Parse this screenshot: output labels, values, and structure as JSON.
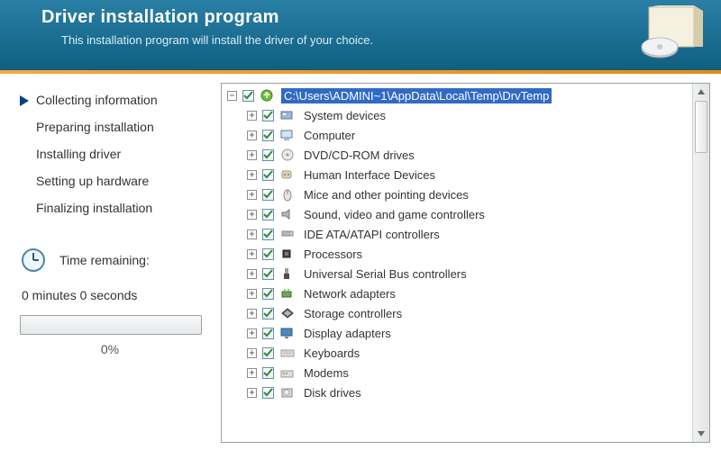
{
  "header": {
    "title": "Driver installation program",
    "subtitle": "This installation program will install the driver of your choice."
  },
  "steps": [
    {
      "label": "Collecting information",
      "active": true
    },
    {
      "label": "Preparing installation",
      "active": false
    },
    {
      "label": "Installing driver",
      "active": false
    },
    {
      "label": "Setting up hardware",
      "active": false
    },
    {
      "label": "Finalizing installation",
      "active": false
    }
  ],
  "time": {
    "label": "Time remaining:",
    "value": "0 minutes 0 seconds",
    "percent": "0%"
  },
  "tree": {
    "root": {
      "label": "C:\\Users\\ADMINI~1\\AppData\\Local\\Temp\\DrvTemp",
      "expanded": true,
      "checked": true,
      "icon": "root"
    },
    "children": [
      {
        "label": "System devices",
        "icon": "system",
        "checked": true
      },
      {
        "label": "Computer",
        "icon": "computer",
        "checked": true
      },
      {
        "label": "DVD/CD-ROM drives",
        "icon": "cdrom",
        "checked": true
      },
      {
        "label": "Human Interface Devices",
        "icon": "hid",
        "checked": true
      },
      {
        "label": "Mice and other pointing devices",
        "icon": "mouse",
        "checked": true
      },
      {
        "label": "Sound, video and game controllers",
        "icon": "sound",
        "checked": true
      },
      {
        "label": "IDE ATA/ATAPI controllers",
        "icon": "ide",
        "checked": true
      },
      {
        "label": "Processors",
        "icon": "cpu",
        "checked": true
      },
      {
        "label": "Universal Serial Bus controllers",
        "icon": "usb",
        "checked": true
      },
      {
        "label": "Network adapters",
        "icon": "network",
        "checked": true
      },
      {
        "label": "Storage controllers",
        "icon": "storage",
        "checked": true
      },
      {
        "label": "Display adapters",
        "icon": "display",
        "checked": true
      },
      {
        "label": "Keyboards",
        "icon": "keyboard",
        "checked": true
      },
      {
        "label": "Modems",
        "icon": "modem",
        "checked": true
      },
      {
        "label": "Disk drives",
        "icon": "disk",
        "checked": true
      }
    ]
  }
}
